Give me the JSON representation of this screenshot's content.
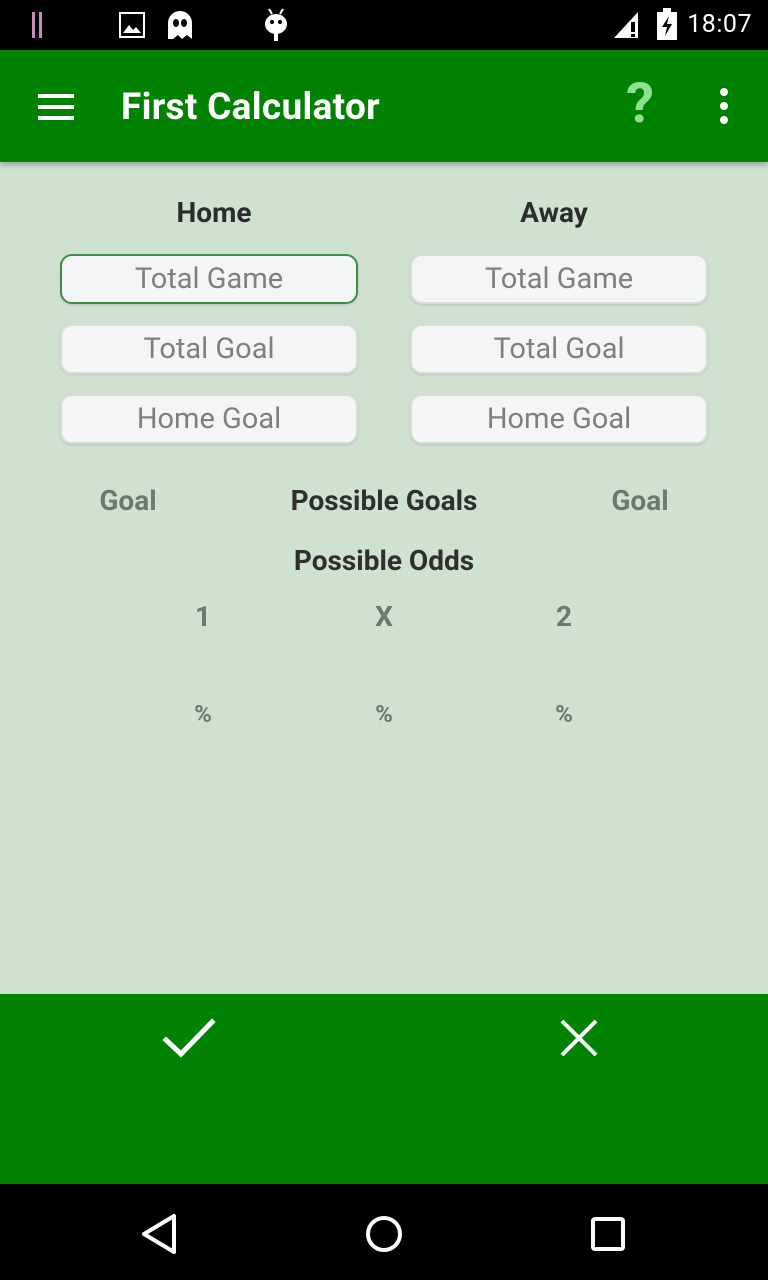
{
  "status_bar": {
    "time": "18:07"
  },
  "app_bar": {
    "title": "First Calculator",
    "help_label": "?"
  },
  "home": {
    "heading": "Home",
    "total_game_placeholder": "Total Game",
    "total_goal_placeholder": "Total Goal",
    "home_goal_placeholder": "Home Goal"
  },
  "away": {
    "heading": "Away",
    "total_game_placeholder": "Total Game",
    "total_goal_placeholder": "Total Goal",
    "home_goal_placeholder": "Home Goal"
  },
  "results": {
    "home_goal_label": "Goal",
    "possible_goals_label": "Possible Goals",
    "away_goal_label": "Goal",
    "possible_odds_label": "Possible Odds",
    "odds": [
      {
        "label": "1",
        "percent": "%"
      },
      {
        "label": "X",
        "percent": "%"
      },
      {
        "label": "2",
        "percent": "%"
      }
    ]
  },
  "icons": {
    "accent_green": "#028202",
    "help_color": "#8fe08f",
    "confirm": "check-icon",
    "cancel": "close-icon"
  }
}
